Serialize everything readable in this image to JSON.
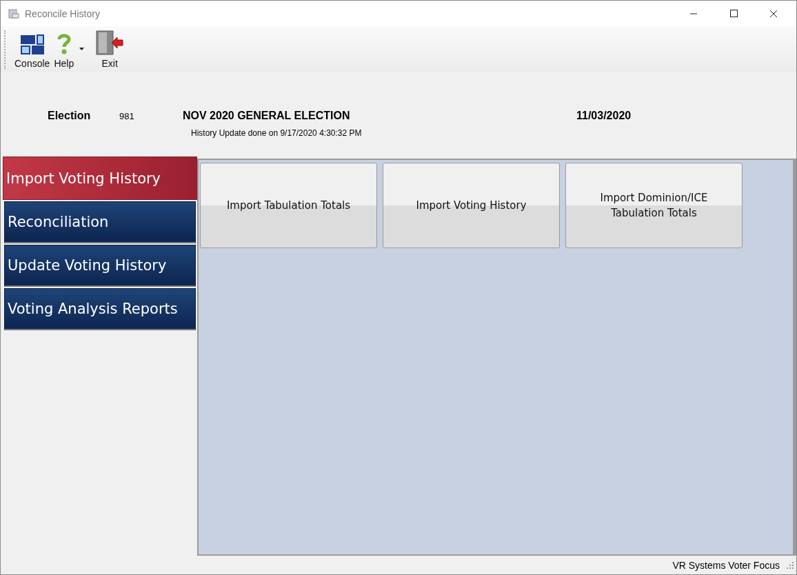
{
  "window": {
    "title": "Reconcile History"
  },
  "toolbar": [
    {
      "kind": "console",
      "label": "Console",
      "has_dropdown": false
    },
    {
      "kind": "help",
      "label": "Help",
      "has_dropdown": true
    },
    {
      "kind": "exit",
      "label": "Exit",
      "has_dropdown": false
    }
  ],
  "election": {
    "label": "Election",
    "number": "981",
    "name": "NOV 2020 GENERAL ELECTION",
    "date": "11/03/2020",
    "update_note": "History Update done on 9/17/2020 4:30:32 PM"
  },
  "sidebar": {
    "items": [
      {
        "label": "Import Voting History",
        "selected": true
      },
      {
        "label": "Reconciliation",
        "selected": false
      },
      {
        "label": "Update Voting History",
        "selected": false
      },
      {
        "label": "Voting Analysis Reports",
        "selected": false
      }
    ]
  },
  "actions": [
    {
      "label": "Import Tabulation Totals"
    },
    {
      "label": "Import Voting History"
    },
    {
      "label": "Import Dominion/ICE\nTabulation Totals"
    }
  ],
  "status_bar": {
    "text": "VR Systems Voter Focus"
  }
}
